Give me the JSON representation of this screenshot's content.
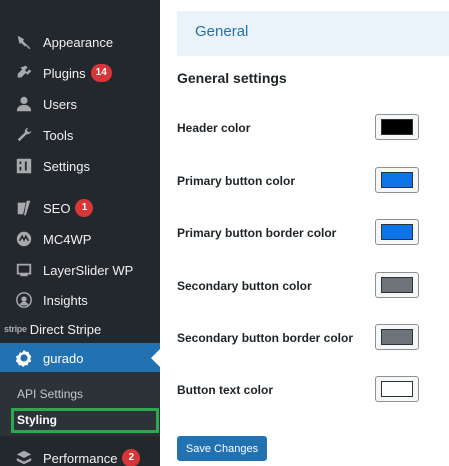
{
  "sidebar": {
    "items": [
      {
        "label": "Appearance",
        "icon": "paintbrush-icon"
      },
      {
        "label": "Plugins",
        "icon": "plugin-icon",
        "badge": "14"
      },
      {
        "label": "Users",
        "icon": "users-icon"
      },
      {
        "label": "Tools",
        "icon": "wrench-icon"
      },
      {
        "label": "Settings",
        "icon": "settings-icon"
      },
      {
        "label": "SEO",
        "icon": "seo-icon",
        "badge": "1"
      },
      {
        "label": "MC4WP",
        "icon": "mc4wp-icon"
      },
      {
        "label": "LayerSlider WP",
        "icon": "layerslider-icon"
      },
      {
        "label": "Insights",
        "icon": "insights-icon"
      },
      {
        "label": "Direct Stripe",
        "icon_text": "stripe"
      },
      {
        "label": "gurado",
        "icon": "gear-icon",
        "active": true
      },
      {
        "label": "Performance",
        "icon": "performance-icon",
        "badge": "2"
      }
    ],
    "submenu": [
      {
        "label": "API Settings"
      },
      {
        "label": "Styling",
        "current": true
      }
    ]
  },
  "tab": {
    "label": "General"
  },
  "section_title": "General settings",
  "settings": [
    {
      "label": "Header color",
      "color": "#000000"
    },
    {
      "label": "Primary button color",
      "color": "#0c74e6"
    },
    {
      "label": "Primary button border color",
      "color": "#0c74e6"
    },
    {
      "label": "Secondary button color",
      "color": "#6e747a"
    },
    {
      "label": "Secondary button border color",
      "color": "#6e747a"
    },
    {
      "label": "Button text color",
      "color": "#ffffff"
    }
  ],
  "save_label": "Save Changes",
  "colors": {
    "sidebar_bg": "#23282d",
    "accent": "#2271b1",
    "highlight": "#2ea84f",
    "badge": "#d63638"
  }
}
